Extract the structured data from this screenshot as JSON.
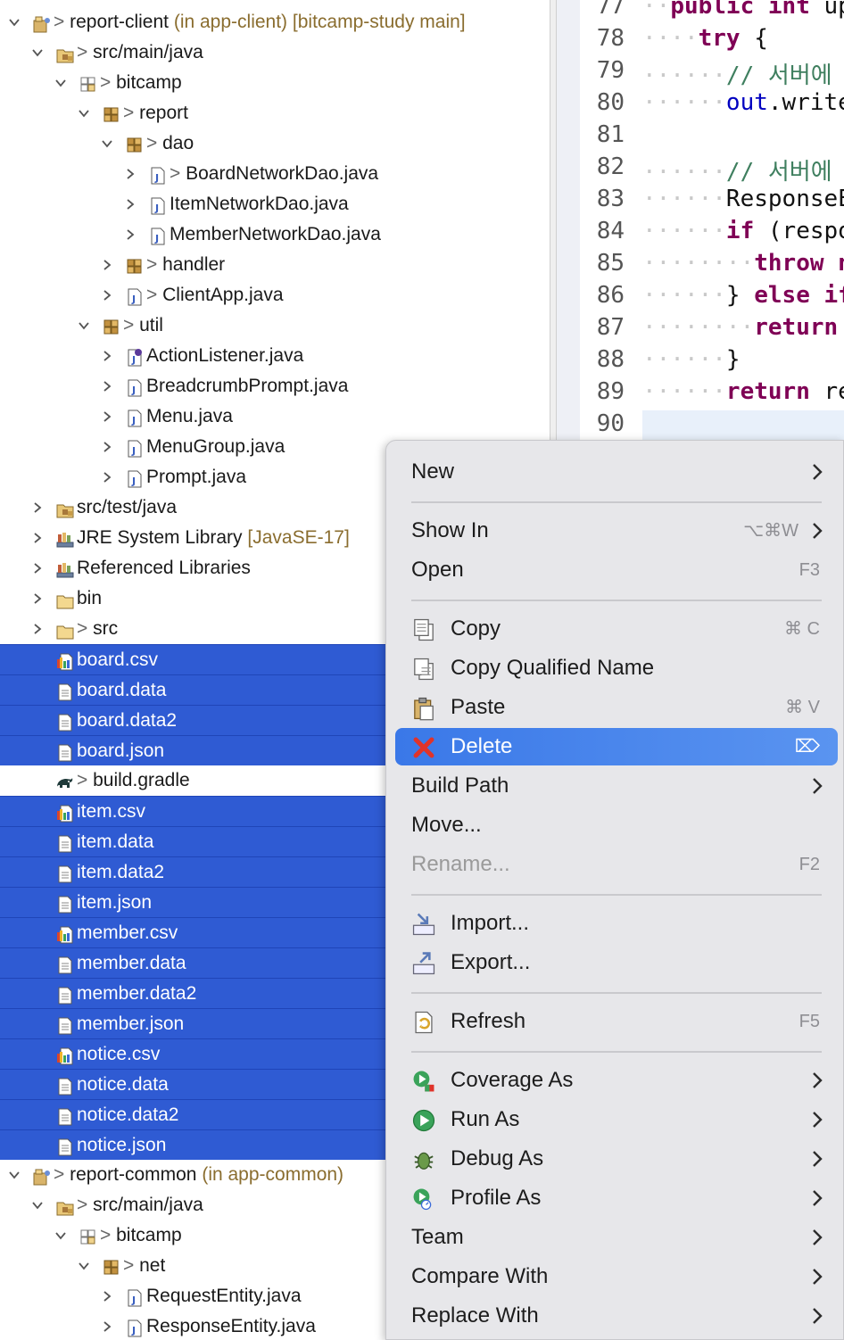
{
  "tree": {
    "rows": [
      {
        "label": "report-client",
        "decor": "(in app-client) [bitcamp-study main]",
        "indent": 0,
        "expanded": true,
        "icon": "project-icon",
        "gt": true,
        "selected": false
      },
      {
        "label": "src/main/java",
        "indent": 1,
        "expanded": true,
        "icon": "source-folder-icon",
        "gt": true,
        "selected": false
      },
      {
        "label": "bitcamp",
        "indent": 2,
        "expanded": true,
        "icon": "package-empty-icon",
        "gt": true,
        "selected": false
      },
      {
        "label": "report",
        "indent": 3,
        "expanded": true,
        "icon": "package-icon",
        "gt": true,
        "selected": false
      },
      {
        "label": "dao",
        "indent": 4,
        "expanded": true,
        "icon": "package-icon",
        "gt": true,
        "selected": false
      },
      {
        "label": "BoardNetworkDao.java",
        "indent": 5,
        "expanded": false,
        "icon": "java-file-icon",
        "gt": true,
        "selected": false
      },
      {
        "label": "ItemNetworkDao.java",
        "indent": 5,
        "expanded": false,
        "icon": "java-file-icon",
        "gt": false,
        "selected": false
      },
      {
        "label": "MemberNetworkDao.java",
        "indent": 5,
        "expanded": false,
        "icon": "java-file-icon",
        "gt": false,
        "selected": false
      },
      {
        "label": "handler",
        "indent": 4,
        "expanded": false,
        "icon": "package-icon",
        "gt": true,
        "selected": false
      },
      {
        "label": "ClientApp.java",
        "indent": 4,
        "expanded": false,
        "icon": "java-file-icon",
        "gt": true,
        "selected": false
      },
      {
        "label": "util",
        "indent": 3,
        "expanded": true,
        "icon": "package-icon",
        "gt": true,
        "selected": false
      },
      {
        "label": "ActionListener.java",
        "indent": 4,
        "expanded": false,
        "icon": "java-interface-icon",
        "gt": false,
        "selected": false
      },
      {
        "label": "BreadcrumbPrompt.java",
        "indent": 4,
        "expanded": false,
        "icon": "java-file-icon",
        "gt": false,
        "selected": false
      },
      {
        "label": "Menu.java",
        "indent": 4,
        "expanded": false,
        "icon": "java-file-icon",
        "gt": false,
        "selected": false
      },
      {
        "label": "MenuGroup.java",
        "indent": 4,
        "expanded": false,
        "icon": "java-file-icon",
        "gt": false,
        "selected": false
      },
      {
        "label": "Prompt.java",
        "indent": 4,
        "expanded": false,
        "icon": "java-file-icon",
        "gt": false,
        "selected": false
      },
      {
        "label": "src/test/java",
        "indent": 1,
        "expanded": false,
        "icon": "source-folder-icon",
        "gt": false,
        "selected": false
      },
      {
        "label": "JRE System Library",
        "decor": "[JavaSE-17]",
        "indent": 1,
        "expanded": false,
        "icon": "library-icon",
        "gt": false,
        "selected": false
      },
      {
        "label": "Referenced Libraries",
        "indent": 1,
        "expanded": false,
        "icon": "library-icon",
        "gt": false,
        "selected": false
      },
      {
        "label": "bin",
        "indent": 1,
        "expanded": false,
        "icon": "folder-icon",
        "gt": false,
        "selected": false
      },
      {
        "label": "src",
        "indent": 1,
        "expanded": false,
        "icon": "folder-icon",
        "gt": true,
        "selected": false
      },
      {
        "label": "board.csv",
        "indent": 1,
        "leaf": true,
        "icon": "csv-file-icon",
        "gt": false,
        "selected": true
      },
      {
        "label": "board.data",
        "indent": 1,
        "leaf": true,
        "icon": "text-file-icon",
        "gt": false,
        "selected": true
      },
      {
        "label": "board.data2",
        "indent": 1,
        "leaf": true,
        "icon": "text-file-icon",
        "gt": false,
        "selected": true
      },
      {
        "label": "board.json",
        "indent": 1,
        "leaf": true,
        "icon": "text-file-icon",
        "gt": false,
        "selected": true
      },
      {
        "label": "build.gradle",
        "indent": 1,
        "leaf": true,
        "icon": "gradle-icon",
        "gt": true,
        "selected": false
      },
      {
        "label": "item.csv",
        "indent": 1,
        "leaf": true,
        "icon": "csv-file-icon",
        "gt": false,
        "selected": true
      },
      {
        "label": "item.data",
        "indent": 1,
        "leaf": true,
        "icon": "text-file-icon",
        "gt": false,
        "selected": true
      },
      {
        "label": "item.data2",
        "indent": 1,
        "leaf": true,
        "icon": "text-file-icon",
        "gt": false,
        "selected": true
      },
      {
        "label": "item.json",
        "indent": 1,
        "leaf": true,
        "icon": "text-file-icon",
        "gt": false,
        "selected": true
      },
      {
        "label": "member.csv",
        "indent": 1,
        "leaf": true,
        "icon": "csv-file-icon",
        "gt": false,
        "selected": true
      },
      {
        "label": "member.data",
        "indent": 1,
        "leaf": true,
        "icon": "text-file-icon",
        "gt": false,
        "selected": true
      },
      {
        "label": "member.data2",
        "indent": 1,
        "leaf": true,
        "icon": "text-file-icon",
        "gt": false,
        "selected": true
      },
      {
        "label": "member.json",
        "indent": 1,
        "leaf": true,
        "icon": "text-file-icon",
        "gt": false,
        "selected": true
      },
      {
        "label": "notice.csv",
        "indent": 1,
        "leaf": true,
        "icon": "csv-file-icon",
        "gt": false,
        "selected": true
      },
      {
        "label": "notice.data",
        "indent": 1,
        "leaf": true,
        "icon": "text-file-icon",
        "gt": false,
        "selected": true
      },
      {
        "label": "notice.data2",
        "indent": 1,
        "leaf": true,
        "icon": "text-file-icon",
        "gt": false,
        "selected": true
      },
      {
        "label": "notice.json",
        "indent": 1,
        "leaf": true,
        "icon": "text-file-icon",
        "gt": false,
        "selected": true
      },
      {
        "label": "report-common",
        "decor": "(in app-common)",
        "indent": 0,
        "expanded": true,
        "icon": "project-icon",
        "gt": true,
        "selected": false
      },
      {
        "label": "src/main/java",
        "indent": 1,
        "expanded": true,
        "icon": "source-folder-icon",
        "gt": true,
        "selected": false
      },
      {
        "label": "bitcamp",
        "indent": 2,
        "expanded": true,
        "icon": "package-empty-icon",
        "gt": true,
        "selected": false
      },
      {
        "label": "net",
        "indent": 3,
        "expanded": true,
        "icon": "package-icon",
        "gt": true,
        "selected": false
      },
      {
        "label": "RequestEntity.java",
        "indent": 4,
        "expanded": false,
        "icon": "java-file-icon",
        "gt": false,
        "selected": false
      },
      {
        "label": "ResponseEntity.java",
        "indent": 4,
        "expanded": false,
        "icon": "java-file-icon",
        "gt": false,
        "selected": false
      }
    ]
  },
  "editor": {
    "lines": [
      {
        "n": "77",
        "dots": "··",
        "parts": [
          {
            "t": "public int ",
            "c": "kw"
          },
          {
            "t": "up",
            "c": ""
          }
        ]
      },
      {
        "n": "78",
        "dots": "····",
        "parts": [
          {
            "t": "try",
            "c": "kw"
          },
          {
            "t": " {",
            "c": ""
          }
        ]
      },
      {
        "n": "79",
        "dots": "······",
        "parts": [
          {
            "t": "// 서버에",
            "c": "cm"
          }
        ]
      },
      {
        "n": "80",
        "dots": "······",
        "parts": [
          {
            "t": "out",
            "c": "fld"
          },
          {
            "t": ".write",
            "c": ""
          }
        ]
      },
      {
        "n": "81",
        "dots": "",
        "parts": []
      },
      {
        "n": "82",
        "dots": "······",
        "parts": [
          {
            "t": "// 서버에",
            "c": "cm"
          }
        ]
      },
      {
        "n": "83",
        "dots": "······",
        "parts": [
          {
            "t": "ResponseE",
            "c": ""
          }
        ]
      },
      {
        "n": "84",
        "dots": "······",
        "parts": [
          {
            "t": "if",
            "c": "kw"
          },
          {
            "t": " (respo",
            "c": ""
          }
        ]
      },
      {
        "n": "85",
        "dots": "········",
        "parts": [
          {
            "t": "throw n",
            "c": "kw"
          }
        ]
      },
      {
        "n": "86",
        "dots": "······",
        "parts": [
          {
            "t": "} ",
            "c": ""
          },
          {
            "t": "else if",
            "c": "kw"
          }
        ]
      },
      {
        "n": "87",
        "dots": "········",
        "parts": [
          {
            "t": "return",
            "c": "kw"
          }
        ]
      },
      {
        "n": "88",
        "dots": "······",
        "parts": [
          {
            "t": "}",
            "c": ""
          }
        ]
      },
      {
        "n": "89",
        "dots": "······",
        "parts": [
          {
            "t": "return",
            "c": "kw"
          },
          {
            "t": " re",
            "c": ""
          }
        ]
      },
      {
        "n": "90",
        "dots": "",
        "parts": []
      }
    ]
  },
  "menu": {
    "items": [
      {
        "type": "item",
        "label": "New",
        "arrow": true,
        "icon": ""
      },
      {
        "type": "sep"
      },
      {
        "type": "item",
        "label": "Show In",
        "shortcut": "⌥⌘W",
        "arrow": true,
        "icon": ""
      },
      {
        "type": "item",
        "label": "Open",
        "shortcut": "F3",
        "icon": ""
      },
      {
        "type": "sep"
      },
      {
        "type": "item",
        "label": "Copy",
        "shortcut": "⌘ C",
        "icon": "copy-icon"
      },
      {
        "type": "item",
        "label": "Copy Qualified Name",
        "icon": "copy-qualified-icon"
      },
      {
        "type": "item",
        "label": "Paste",
        "shortcut": "⌘ V",
        "icon": "paste-icon"
      },
      {
        "type": "item",
        "label": "Delete",
        "shortcut": "⌦",
        "icon": "delete-icon",
        "highlight": true
      },
      {
        "type": "item",
        "label": "Build Path",
        "arrow": true,
        "icon": ""
      },
      {
        "type": "item",
        "label": "Move...",
        "icon": ""
      },
      {
        "type": "item",
        "label": "Rename...",
        "shortcut": "F2",
        "icon": "",
        "disabled": true
      },
      {
        "type": "sep"
      },
      {
        "type": "item",
        "label": "Import...",
        "icon": "import-icon"
      },
      {
        "type": "item",
        "label": "Export...",
        "icon": "export-icon"
      },
      {
        "type": "sep"
      },
      {
        "type": "item",
        "label": "Refresh",
        "shortcut": "F5",
        "icon": "refresh-icon"
      },
      {
        "type": "sep"
      },
      {
        "type": "item",
        "label": "Coverage As",
        "arrow": true,
        "icon": "coverage-icon"
      },
      {
        "type": "item",
        "label": "Run As",
        "arrow": true,
        "icon": "run-icon"
      },
      {
        "type": "item",
        "label": "Debug As",
        "arrow": true,
        "icon": "debug-icon"
      },
      {
        "type": "item",
        "label": "Profile As",
        "arrow": true,
        "icon": "profile-icon"
      },
      {
        "type": "item",
        "label": "Team",
        "arrow": true,
        "icon": ""
      },
      {
        "type": "item",
        "label": "Compare With",
        "arrow": true,
        "icon": ""
      },
      {
        "type": "item",
        "label": "Replace With",
        "arrow": true,
        "icon": ""
      }
    ]
  },
  "colors": {
    "selection": "#2f5bd3",
    "menu_highlight": "#3a78e8",
    "menu_bg": "#e7e7ea"
  }
}
